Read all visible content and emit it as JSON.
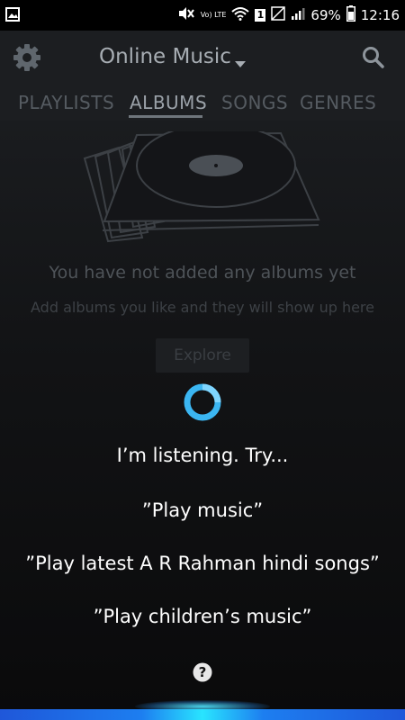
{
  "status_bar": {
    "left_icon": "image-notification-icon",
    "battery": "69%",
    "time": "12:16",
    "lte_label": "Vo) LTE",
    "sim_label": "1"
  },
  "app_bar": {
    "title": "Online Music",
    "menu_icon": "gear-icon",
    "search_icon": "search-icon"
  },
  "tabs": [
    {
      "label": "PLAYLISTS",
      "active": false
    },
    {
      "label": "ALBUMS",
      "active": true
    },
    {
      "label": "SONGS",
      "active": false
    },
    {
      "label": "GENRES",
      "active": false
    }
  ],
  "empty_state": {
    "title": "You have not added any albums yet",
    "subtitle": "Add albums you like and they will show up here",
    "button": "Explore"
  },
  "assistant": {
    "listening": "I’m listening. Try...",
    "suggestions": [
      "”Play music”",
      "”Play latest A R Rahman hindi songs”",
      "”Play children’s music”"
    ]
  },
  "colors": {
    "app_bar": "#1c1e21",
    "accent_ring": "#3bb6f2",
    "bottom_glow": "#29e4ff"
  }
}
